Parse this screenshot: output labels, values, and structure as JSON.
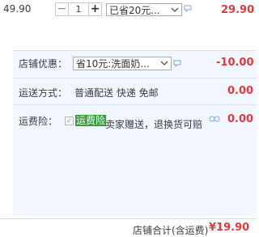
{
  "item": {
    "unit_price": "49.90",
    "quantity": "1",
    "minus_symbol": "−",
    "plus_symbol": "+",
    "discount_select": "已省20元...",
    "line_total": "29.90"
  },
  "shop": {
    "promo_label": "店铺优惠：",
    "promo_select": "省10元:洗面奶...",
    "promo_value": "-10.00",
    "shipping_label": "运送方式：",
    "shipping_method": "普通配送 快递 免邮",
    "shipping_value": "0.00",
    "insurance_label": "运费险：",
    "insurance_badge": "运费险",
    "insurance_desc": "卖家赠送，退换货可赔",
    "insurance_value": "0.00"
  },
  "footer": {
    "total_label": "店铺合计(含运费)",
    "total_value": "¥19.90"
  },
  "colors": {
    "accent_red": "#e4393c",
    "panel_bg": "#f2f7ff",
    "badge_green": "#3c9a3c"
  },
  "icons": [
    "message-icon",
    "chevron-down-icon",
    "checkbox-icon"
  ]
}
